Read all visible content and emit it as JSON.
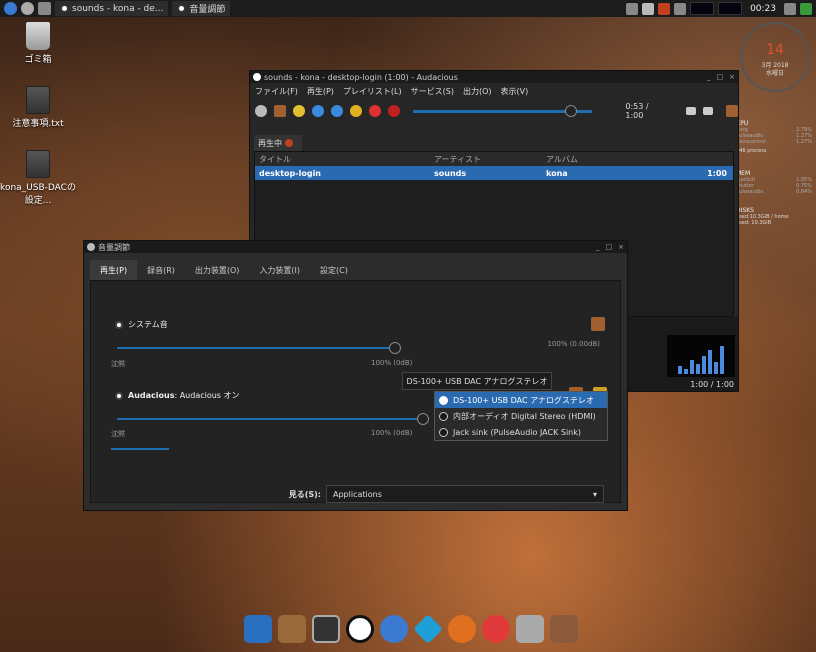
{
  "taskbar": {
    "items": [
      {
        "label": "sounds - kona - de..."
      },
      {
        "label": "音量調節"
      }
    ],
    "clock": "00:23"
  },
  "desktop": {
    "icons": [
      {
        "label": "ゴミ箱"
      },
      {
        "label": "注意事項.txt"
      },
      {
        "label": "kona_USB-DACの設定..."
      }
    ]
  },
  "conky": {
    "day": "14",
    "month": "3月 2018",
    "weekday": "水曜日",
    "cpu_title": "CPU",
    "cpu_rows": [
      {
        "name": "Xorg",
        "value": "2.79%"
      },
      {
        "name": "pulseaudio",
        "value": "1.27%"
      },
      {
        "name": "pavucontrol",
        "value": "1.27%"
      }
    ],
    "processes": "646 process",
    "mem_title": "MEM",
    "mem_rows": [
      {
        "name": "qjackctl",
        "value": "1.05%"
      },
      {
        "name": "shutter",
        "value": "0.75%"
      },
      {
        "name": "pulseaudio",
        "value": "0.64%"
      }
    ],
    "disk_title": "DISKS",
    "disk_home": "used:10.3GiB / home",
    "disk_root": "used: 10.3GiB"
  },
  "audacious": {
    "title": "sounds - kona - desktop-login (1:00) - Audacious",
    "menu": [
      "ファイル(F)",
      "再生(P)",
      "プレイリスト(L)",
      "サービス(S)",
      "出力(O)",
      "表示(V)"
    ],
    "time": "0:53 / 1:00",
    "seek_fraction": 0.88,
    "playlist_tab": "再生中",
    "columns": [
      "タイトル",
      "アーティスト",
      "アルバム"
    ],
    "rows": [
      {
        "title": "desktop-login",
        "artist": "sounds",
        "album": "kona",
        "length": "1:00"
      }
    ],
    "status_time": "1:00 / 1:00"
  },
  "volume": {
    "title": "音量調節",
    "tabs": [
      "再生(P)",
      "録音(R)",
      "出力装置(O)",
      "入力装置(I)",
      "設定(C)"
    ],
    "system_sound": {
      "label": "システム音",
      "value_text": "100% (0.00dB)",
      "scale_left": "沈黙",
      "scale_mid": "100% (0dB)"
    },
    "audacious_stream": {
      "app": "Audacious",
      "desc": ": Audacious オン",
      "device": "DS-100+ USB DAC アナログステレオ",
      "scale_left": "沈黙",
      "scale_mid": "100% (0dB)"
    },
    "dropdown_items": [
      "DS-100+ USB DAC アナログステレオ",
      "内部オーディオ Digital Stereo (HDMI)",
      "Jack sink (PulseAudio JACK Sink)"
    ],
    "show_label": "見る(S):",
    "show_value": "Applications"
  },
  "colors": {
    "accent": "#2a6ab0",
    "panel_bg": "#1c1c1c",
    "window_bg": "#2c2c2c"
  }
}
